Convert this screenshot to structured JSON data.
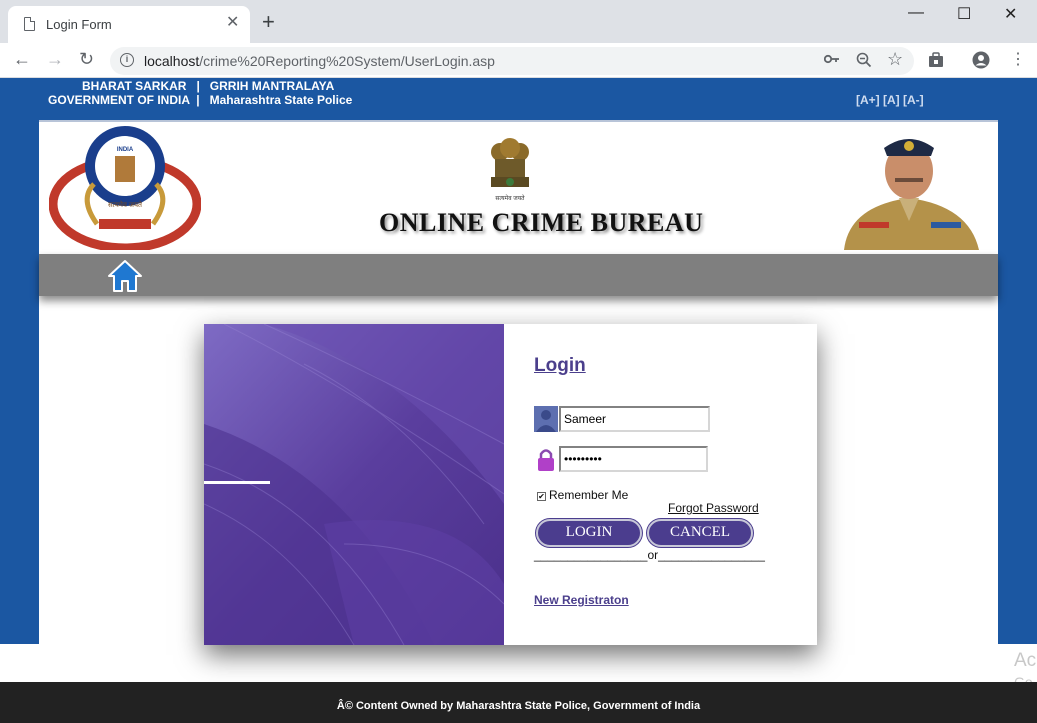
{
  "browser": {
    "tab_title": "Login Form",
    "tab_close": "✕",
    "new_tab": "+",
    "url_host": "localhost",
    "url_path": "/crime%20Reporting%20System/UserLogin.asp",
    "window_minimize": "—",
    "window_maximize": "☐",
    "window_close": "✕"
  },
  "header": {
    "line1": "BHARAT SARKAR   |   GRRIH MANTRALAYA",
    "line2": "GOVERNMENT OF INDIA  |   Maharashtra State Police",
    "font_size_controls": "[A+] [A] [A-]"
  },
  "banner": {
    "title": "ONLINE CRIME BUREAU",
    "cbi_logo_text_top": "CENTRAL BUREAU OF INVESTIGATION",
    "cbi_logo_text_india": "INDIA",
    "cbi_logo_text_bottom": "INDUSTRY  IMPARTIALITY  INTEGRITY",
    "emblem_motto": "सत्यमेव जयते"
  },
  "login": {
    "title": "Login",
    "username_value": "Sameer",
    "password_value": "•••••••••",
    "remember_label": "Remember Me",
    "remember_checked": true,
    "forgot_password": "Forgot Password ",
    "login_button": "LOGIN",
    "cancel_button": "CANCEL",
    "or_separator": "_________________or________________",
    "new_registration": "New Registraton"
  },
  "footer": {
    "text": "Â© Content Owned by Maharashtra State Police, Government of India"
  },
  "watermark": {
    "line1": "Ac",
    "line2": "Go"
  },
  "colors": {
    "header_blue": "#1b57a2",
    "nav_gray": "#7f7f7f",
    "button_purple": "#4b3d8e",
    "footer_dark": "#222222"
  }
}
